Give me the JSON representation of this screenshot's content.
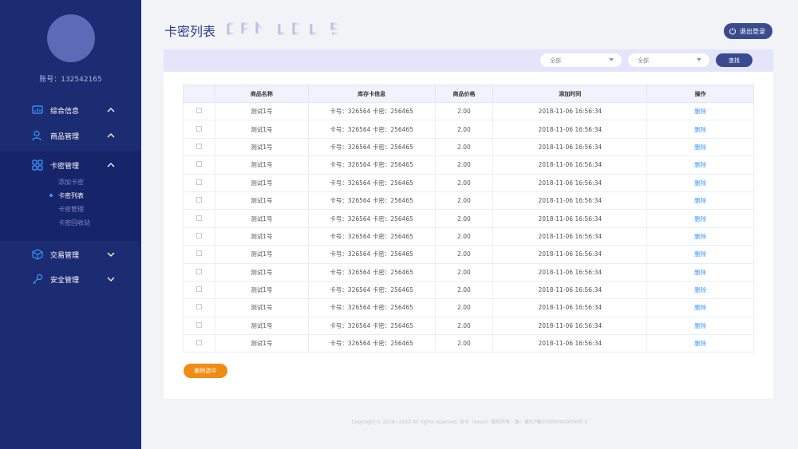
{
  "sidebar": {
    "account": "账号：132542165",
    "nav": [
      {
        "label": "综合信息",
        "icon": "dashboard-icon",
        "expanded": false
      },
      {
        "label": "商品管理",
        "icon": "user-goods-icon",
        "expanded": false
      },
      {
        "label": "卡密管理",
        "icon": "grid-icon",
        "expanded": true
      },
      {
        "label": "交易管理",
        "icon": "box-icon",
        "expanded": false
      },
      {
        "label": "安全管理",
        "icon": "key-icon",
        "expanded": false
      }
    ],
    "submenu": [
      "添加卡密",
      "卡密列表",
      "卡密管理",
      "卡密回收站"
    ],
    "active_sub": "卡密列表"
  },
  "header": {
    "title": "卡密列表",
    "logout": "退出登录"
  },
  "filters": {
    "select1": "全部",
    "select2": "全部",
    "search": "查找"
  },
  "table": {
    "headers": [
      "",
      "商品名称",
      "库存卡信息",
      "商品价格",
      "添加时间",
      "操作"
    ],
    "rows": [
      {
        "name": "测试1号",
        "info": "卡号：326564  卡密：256465",
        "price": "2.00",
        "time": "2018-11-06  16:56:34",
        "action": "删除"
      },
      {
        "name": "测试1号",
        "info": "卡号：326564  卡密：256465",
        "price": "2.00",
        "time": "2018-11-06  16:56:34",
        "action": "删除"
      },
      {
        "name": "测试1号",
        "info": "卡号：326564  卡密：256465",
        "price": "2.00",
        "time": "2018-11-06  16:56:34",
        "action": "删除"
      },
      {
        "name": "测试1号",
        "info": "卡号：326564  卡密：256465",
        "price": "2.00",
        "time": "2018-11-06  16:56:34",
        "action": "删除"
      },
      {
        "name": "测试1号",
        "info": "卡号：326564  卡密：256465",
        "price": "2.00",
        "time": "2018-11-06  16:56:34",
        "action": "删除"
      },
      {
        "name": "测试1号",
        "info": "卡号：326564  卡密：256465",
        "price": "2.00",
        "time": "2018-11-06  16:56:34",
        "action": "删除"
      },
      {
        "name": "测试1号",
        "info": "卡号：326564  卡密：256465",
        "price": "2.00",
        "time": "2018-11-06  16:56:34",
        "action": "删除"
      },
      {
        "name": "测试1号",
        "info": "卡号：326564  卡密：256465",
        "price": "2.00",
        "time": "2018-11-06  16:56:34",
        "action": "删除"
      },
      {
        "name": "测试1号",
        "info": "卡号：326564  卡密：256465",
        "price": "2.00",
        "time": "2018-11-06  16:56:34",
        "action": "删除"
      },
      {
        "name": "测试1号",
        "info": "卡号：326564  卡密：256465",
        "price": "2.00",
        "time": "2018-11-06  16:56:34",
        "action": "删除"
      },
      {
        "name": "测试1号",
        "info": "卡号：326564  卡密：256465",
        "price": "2.00",
        "time": "2018-11-06  16:56:34",
        "action": "删除"
      },
      {
        "name": "测试1号",
        "info": "卡号：326564  卡密：256465",
        "price": "2.00",
        "time": "2018-11-06  16:56:34",
        "action": "删除"
      },
      {
        "name": "测试1号",
        "info": "卡号：326564  卡密：256465",
        "price": "2.00",
        "time": "2018-11-06  16:56:34",
        "action": "删除"
      },
      {
        "name": "测试1号",
        "info": "卡号：326564  卡密：256465",
        "price": "2.00",
        "time": "2018-11-06  16:56:34",
        "action": "删除"
      }
    ]
  },
  "actions": {
    "delete_selected": "删除选中"
  },
  "footer": "Copyright © 2018~2020 All rights reserved. 发卡（wwm）版权所有 · 备：黄ICP备000000000000号-5",
  "colors": {
    "sidebar": "#1c2c72",
    "primary": "#3a4a8e",
    "accent_link": "#3f9bff",
    "orange": "#f08c13",
    "filter_bar": "#e4e5fb"
  }
}
